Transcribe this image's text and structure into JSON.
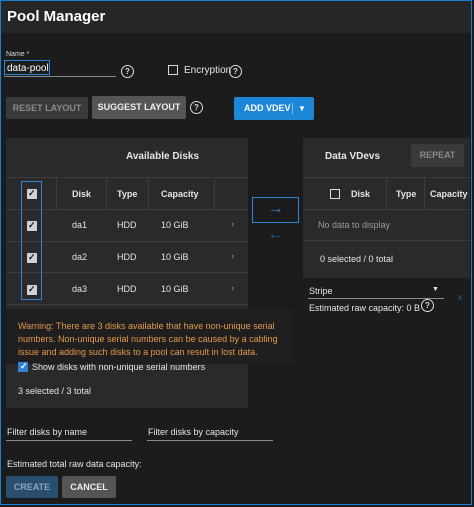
{
  "window": {
    "title": "Pool Manager"
  },
  "name_field": {
    "label": "Name *",
    "value": "data-pool"
  },
  "encryption": {
    "label": "Encryption",
    "checked": false
  },
  "buttons": {
    "reset_layout": "RESET LAYOUT",
    "suggest_layout": "SUGGEST LAYOUT",
    "add_vdev": "ADD VDEV",
    "repeat": "REPEAT",
    "create": "CREATE",
    "cancel": "CANCEL"
  },
  "available_disks": {
    "title": "Available Disks",
    "columns": [
      "Disk",
      "Type",
      "Capacity"
    ],
    "rows": [
      {
        "disk": "da1",
        "type": "HDD",
        "capacity": "10 GiB",
        "checked": true
      },
      {
        "disk": "da2",
        "type": "HDD",
        "capacity": "10 GiB",
        "checked": true
      },
      {
        "disk": "da3",
        "type": "HDD",
        "capacity": "10 GiB",
        "checked": true
      }
    ],
    "warning": "Warning: There are 3 disks available that have non-unique serial numbers. Non-unique serial numbers can be caused by a cabling issue and adding such disks to a pool can result in lost data.",
    "show_non_unique_label": "Show disks with non-unique serial numbers",
    "selection_count": "3 selected / 3 total"
  },
  "data_vdevs": {
    "title": "Data VDevs",
    "columns": [
      "Disk",
      "Type",
      "Capacity"
    ],
    "empty_message": "No data to display",
    "selection_count": "0 selected / 0 total",
    "layout_value": "Stripe",
    "raw_capacity": "Estimated raw capacity: 0 B"
  },
  "filters": {
    "by_name_placeholder": "Filter disks by name",
    "by_capacity_placeholder": "Filter disks by capacity"
  },
  "total_capacity_label": "Estimated total raw data capacity:",
  "colors": {
    "accent": "#1e88d8",
    "warning": "#e59a4a",
    "background": "#1c1c1c"
  }
}
